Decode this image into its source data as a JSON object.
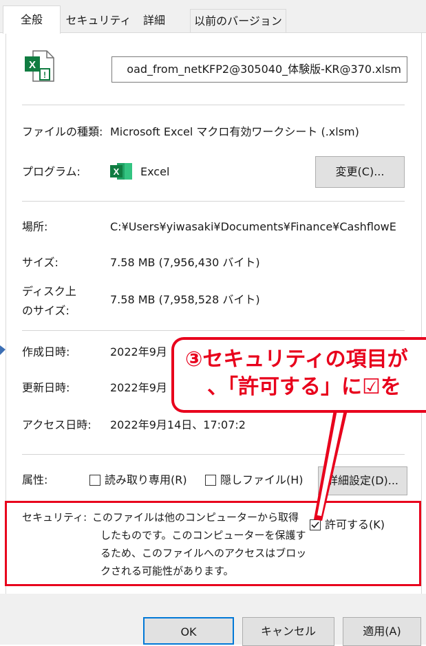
{
  "tabs": [
    "全般",
    "セキュリティ",
    "詳細",
    "以前のバージョン"
  ],
  "filename": "oad_from_netKFP2@305040_体験版-KR@370.xlsm",
  "file_icon": "excel-file-icon",
  "rows": {
    "type_label": "ファイルの種類:",
    "type_value": "Microsoft Excel マクロ有効ワークシート (.xlsm)",
    "program_label": "プログラム:",
    "program_value": "Excel",
    "change_button": "変更(C)...",
    "location_label": "場所:",
    "location_value": "C:¥Users¥yiwasaki¥Documents¥Finance¥CashflowE",
    "size_label": "サイズ:",
    "size_value": "7.58 MB (7,956,430 バイト)",
    "disk_label_1": "ディスク上",
    "disk_label_2": "のサイズ:",
    "disk_value": "7.58 MB (7,958,528 バイト)",
    "created_label": "作成日時:",
    "created_value": "2022年9月",
    "modified_label": "更新日時:",
    "modified_value": "2022年9月",
    "accessed_label": "アクセス日時:",
    "accessed_value": "2022年9月14日、17:07:2"
  },
  "attributes": {
    "label": "属性:",
    "readonly": "読み取り専用(R)",
    "readonly_checked": false,
    "hidden": "隠しファイル(H)",
    "hidden_checked": false,
    "advanced_button": "詳細設定(D)..."
  },
  "security": {
    "label": "セキュリティ:",
    "lines": [
      "このファイルは他のコンピューターから取得",
      "したものです。このコンピューターを保護す",
      "るため、このファイルへのアクセスはブロッ",
      "クされる可能性があります。"
    ],
    "allow": "許可する(K)",
    "allow_checked": true
  },
  "callout": {
    "line1": "③セキュリティの項目が",
    "line2": "、「許可する」に☑を"
  },
  "buttons": {
    "ok": "OK",
    "cancel": "キャンセル",
    "apply": "適用(A)"
  },
  "colors": {
    "annotation": "#e8001c",
    "excel_green": "#107c41",
    "arrow_blue": "#3c6fb4"
  }
}
